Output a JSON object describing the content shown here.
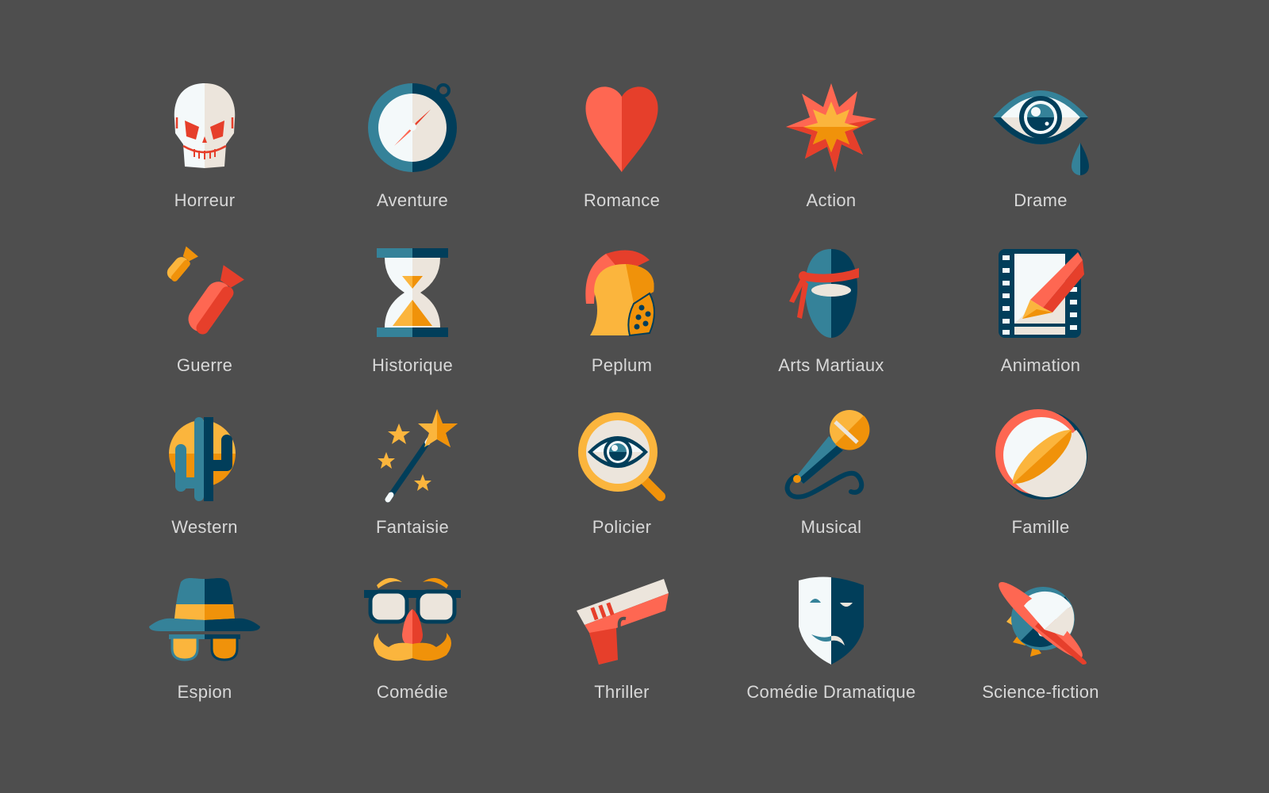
{
  "palette": {
    "background": "#4e4e4e",
    "label": "#d8d8d8",
    "red_light": "#fe6752",
    "red_dark": "#e63f2b",
    "yellow_light": "#fbb53d",
    "yellow_dark": "#f0920a",
    "teal_light": "#358299",
    "teal_dark": "#013e5a",
    "cream_light": "#f4f9fa",
    "cream_dark": "#ece5dc"
  },
  "genres": [
    {
      "label": "Horreur",
      "icon": "skull-icon"
    },
    {
      "label": "Aventure",
      "icon": "compass-icon"
    },
    {
      "label": "Romance",
      "icon": "heart-icon"
    },
    {
      "label": "Action",
      "icon": "explosion-icon"
    },
    {
      "label": "Drame",
      "icon": "crying-eye-icon"
    },
    {
      "label": "Guerre",
      "icon": "bombs-icon"
    },
    {
      "label": "Historique",
      "icon": "hourglass-icon"
    },
    {
      "label": "Peplum",
      "icon": "gladiator-helmet-icon"
    },
    {
      "label": "Arts Martiaux",
      "icon": "ninja-icon"
    },
    {
      "label": "Animation",
      "icon": "film-pencil-icon"
    },
    {
      "label": "Western",
      "icon": "cactus-icon"
    },
    {
      "label": "Fantaisie",
      "icon": "magic-wand-icon"
    },
    {
      "label": "Policier",
      "icon": "magnifier-eye-icon"
    },
    {
      "label": "Musical",
      "icon": "microphone-icon"
    },
    {
      "label": "Famille",
      "icon": "beach-ball-icon"
    },
    {
      "label": "Espion",
      "icon": "spy-hat-icon"
    },
    {
      "label": "Comédie",
      "icon": "groucho-glasses-icon"
    },
    {
      "label": "Thriller",
      "icon": "pistol-icon"
    },
    {
      "label": "Comédie Dramatique",
      "icon": "theater-masks-icon"
    },
    {
      "label": "Science-fiction",
      "icon": "planet-icon"
    }
  ]
}
